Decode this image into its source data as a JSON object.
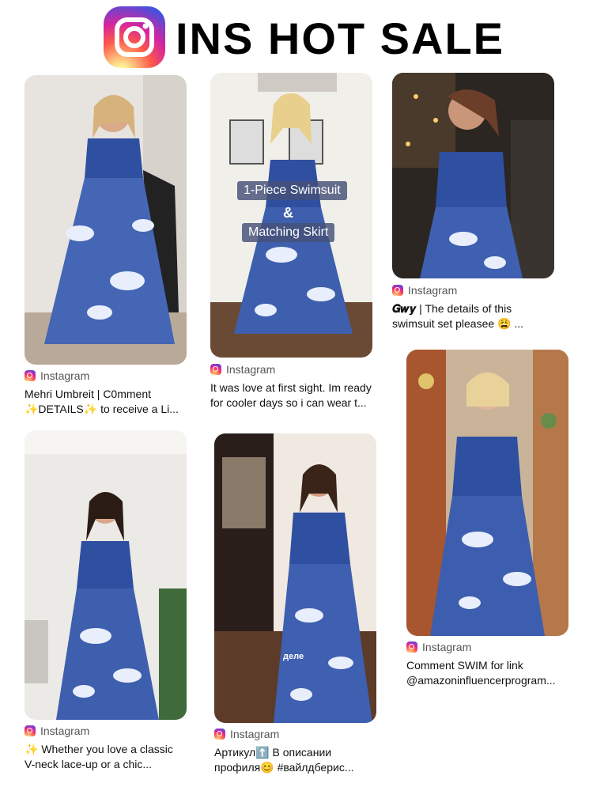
{
  "header": {
    "title": "INS HOT SALE",
    "logo_icon": "instagram-logo-icon"
  },
  "colors": {
    "dress_blue": "#2f4fa0",
    "dress_light": "#e8eefb",
    "caption_text": "#111111",
    "source_text": "#555555"
  },
  "cards": [
    {
      "source": "Instagram",
      "line1": "Mehri Umbreit | C0mment",
      "line2": "✨DETAILS✨ to receive a Li..."
    },
    {
      "source": "Instagram",
      "overlay": [
        "1-Piece Swimsuit",
        "&",
        "Matching Skirt"
      ],
      "line1": "It was love at first sight. Im ready",
      "line2": "for cooler days so i can wear t..."
    },
    {
      "source": "Instagram",
      "author": "𝑮𝒘𝒚",
      "line1": " | The details of this",
      "line2": "swimsuit set pleasee 😩 ..."
    },
    {
      "source": "Instagram",
      "line1": "✨ Whether you love a classic",
      "line2": "V-neck lace-up or a chic..."
    },
    {
      "source": "Instagram",
      "overlay_word": "деле",
      "line1": "Артикул⬆️ В описании",
      "line2": "профиля😊 #вайлдберис..."
    },
    {
      "source": "Instagram",
      "line1": "Comment SWIM for link",
      "line2": "@amazoninfluencerprogram..."
    }
  ]
}
